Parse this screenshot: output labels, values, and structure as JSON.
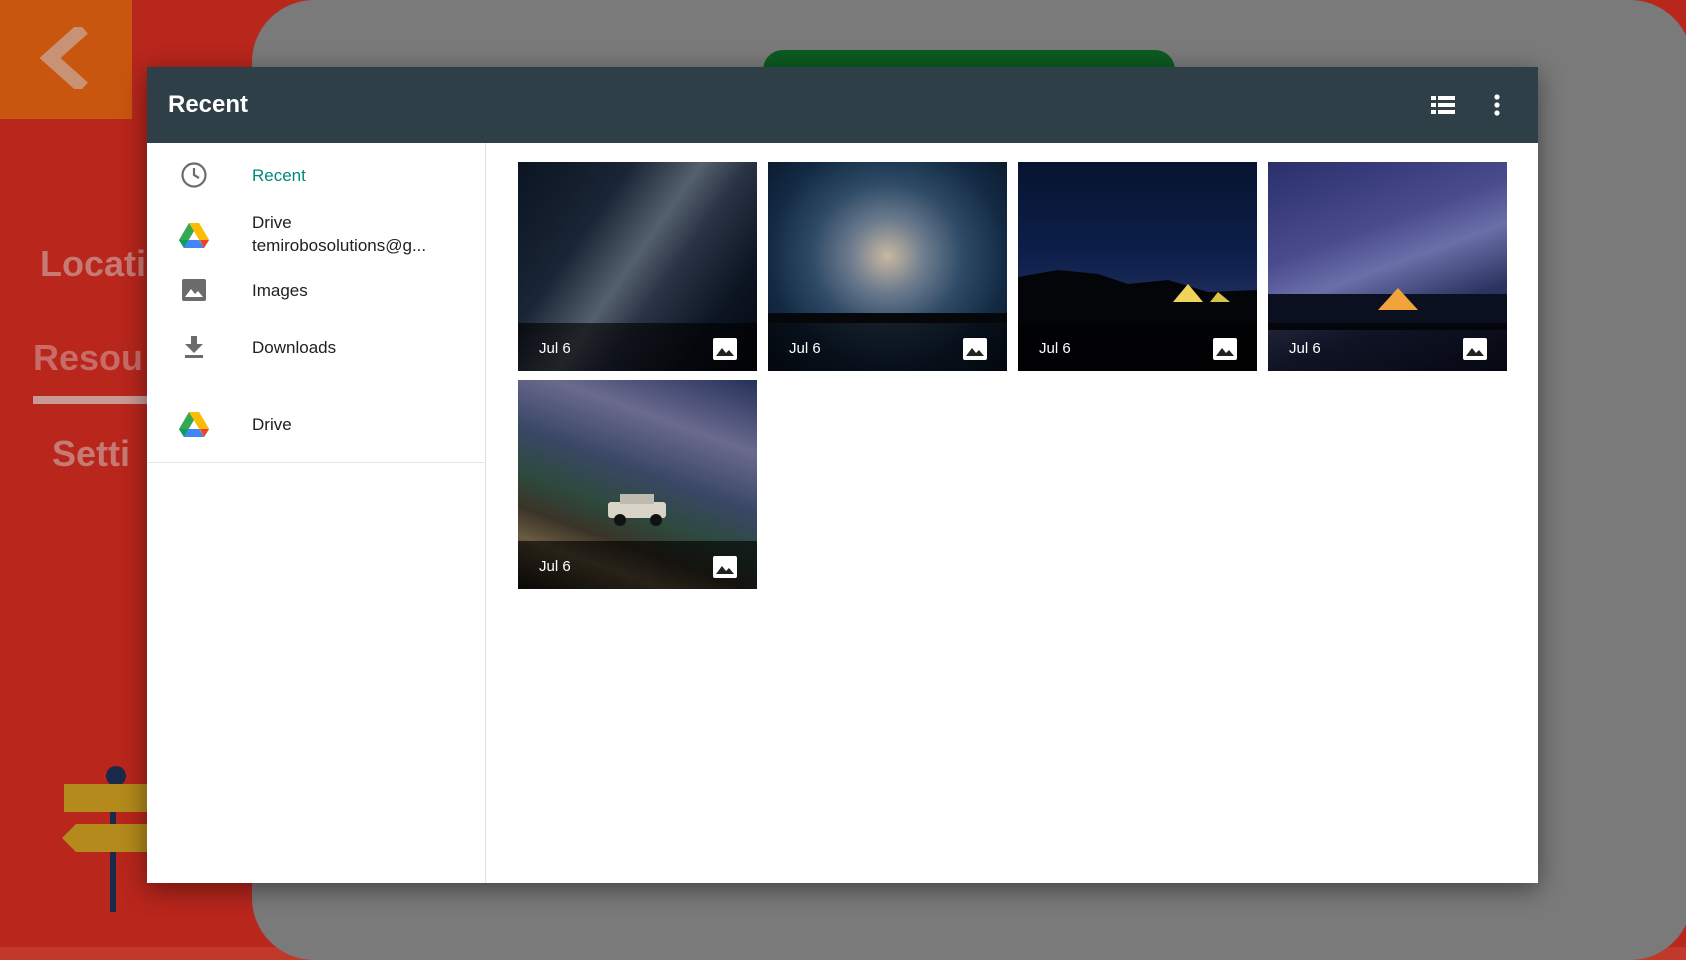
{
  "background_app": {
    "nav": [
      "Locati",
      "Resou",
      "Setti"
    ]
  },
  "dialog": {
    "title": "Recent",
    "toolbar": {
      "list_view_icon": "view-list-icon",
      "more_icon": "more-vert-icon"
    },
    "sidebar": {
      "items": [
        {
          "label": "Recent",
          "icon": "clock-icon",
          "active": true
        },
        {
          "label": "Drive",
          "sublabel": "temirobosolutions@g...",
          "icon": "google-drive-icon"
        },
        {
          "label": "Images",
          "icon": "image-icon"
        },
        {
          "label": "Downloads",
          "icon": "download-icon"
        },
        {
          "label": "Drive",
          "icon": "google-drive-icon"
        }
      ]
    },
    "files": [
      {
        "date": "Jul 6",
        "type_icon": "image-icon",
        "subject": "milky way night sky"
      },
      {
        "date": "Jul 6",
        "type_icon": "image-icon",
        "subject": "milky way over treeline"
      },
      {
        "date": "Jul 6",
        "type_icon": "image-icon",
        "subject": "lit tents at night"
      },
      {
        "date": "Jul 6",
        "type_icon": "image-icon",
        "subject": "tent under milky way"
      },
      {
        "date": "Jul 6",
        "type_icon": "image-icon",
        "subject": "jeep under milky way"
      }
    ]
  },
  "colors": {
    "topbar": "#2f3f48",
    "accent": "#00897b",
    "background_red": "#b8261c"
  }
}
